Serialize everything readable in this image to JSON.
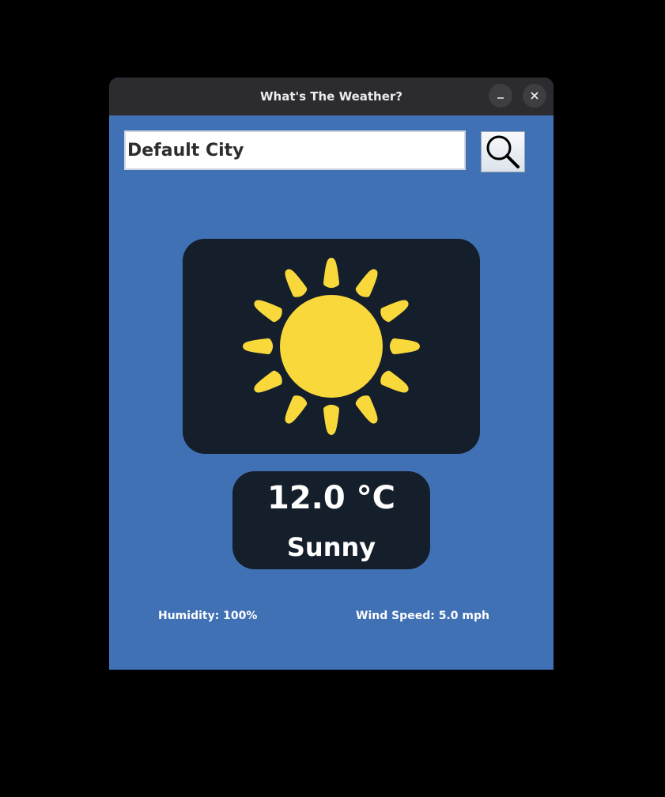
{
  "window": {
    "title": "What's The Weather?"
  },
  "search": {
    "city_value": "Default City"
  },
  "weather": {
    "icon": "sun-icon",
    "temperature": "12.0 °C",
    "condition": "Sunny",
    "humidity": "Humidity: 100%",
    "wind_speed": "Wind Speed: 5.0 mph"
  },
  "colors": {
    "background": "#4171b5",
    "panel": "#141f2b",
    "titlebar": "#2c2c30",
    "sun": "#f9d83b",
    "text": "#ffffff"
  }
}
